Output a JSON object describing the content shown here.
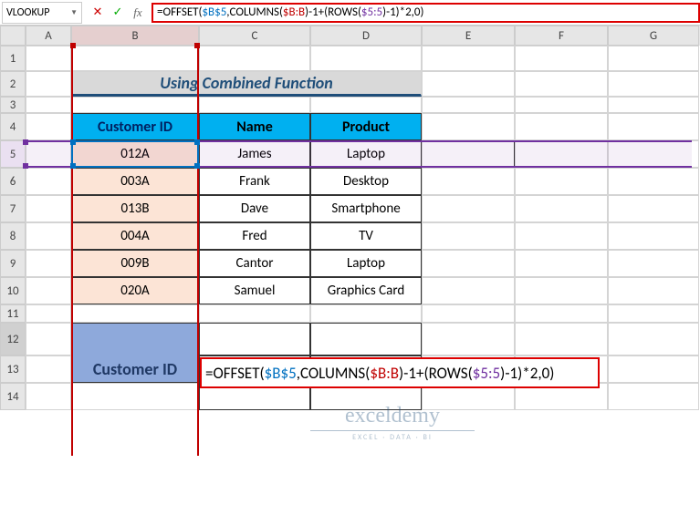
{
  "namebox": {
    "value": "VLOOKUP"
  },
  "formula_bar": {
    "raw": "=OFFSET($B$5,COLUMNS($B:B)-1+(ROWS($5:5)-1)*2,0)",
    "parts": [
      {
        "cls": "part-black",
        "t": "=OFFSET("
      },
      {
        "cls": "part-blue",
        "t": "$B$5"
      },
      {
        "cls": "part-black",
        "t": ",COLUMNS("
      },
      {
        "cls": "part-red",
        "t": "$B:B"
      },
      {
        "cls": "part-black",
        "t": ")-1+(ROWS("
      },
      {
        "cls": "part-purple",
        "t": "$5:5"
      },
      {
        "cls": "part-black",
        "t": ")-1)*2,0)"
      }
    ]
  },
  "col_headers": [
    "A",
    "B",
    "C",
    "D",
    "E",
    "F",
    "G"
  ],
  "row_headers": [
    "1",
    "2",
    "3",
    "4",
    "5",
    "6",
    "7",
    "8",
    "9",
    "10",
    "11",
    "12",
    "13",
    "14"
  ],
  "title": "Using Combined Function",
  "table": {
    "headers": {
      "b": "Customer ID",
      "c": "Name",
      "d": "Product"
    },
    "rows": [
      {
        "b": "012A",
        "c": "James",
        "d": "Laptop"
      },
      {
        "b": "003A",
        "c": "Frank",
        "d": "Desktop"
      },
      {
        "b": "013B",
        "c": "Dave",
        "d": "Smartphone"
      },
      {
        "b": "004A",
        "c": "Fred",
        "d": "TV"
      },
      {
        "b": "009B",
        "c": "Cantor",
        "d": "Laptop"
      },
      {
        "b": "020A",
        "c": "Samuel",
        "d": "Graphics Card"
      }
    ]
  },
  "lower": {
    "label": "Customer ID"
  },
  "c12_formula": {
    "parts": [
      {
        "cls": "part-black",
        "t": "=OFFSET("
      },
      {
        "cls": "part-blue",
        "t": "$B$5"
      },
      {
        "cls": "part-black",
        "t": ",COLUMNS("
      },
      {
        "cls": "part-red",
        "t": "$B:B"
      },
      {
        "cls": "part-black",
        "t": ")-1+(ROWS("
      },
      {
        "cls": "part-purple",
        "t": "$5:5"
      },
      {
        "cls": "part-black",
        "t": ")-1)*2,0)"
      }
    ]
  },
  "watermark": {
    "main": "exceldemy",
    "sub": "EXCEL · DATA · BI"
  }
}
